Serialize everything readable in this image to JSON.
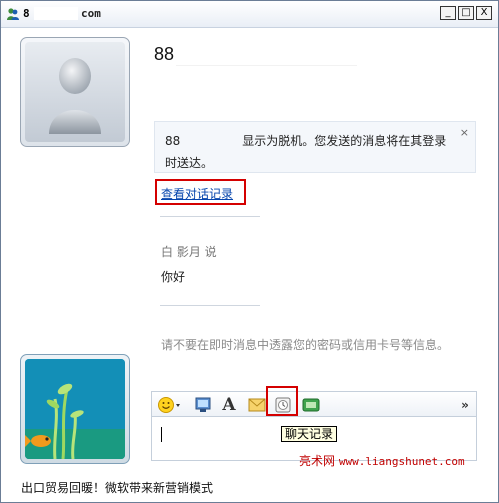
{
  "window": {
    "title_prefix": "8",
    "title_suffix": "com",
    "buttons": [
      "_",
      "□",
      "X"
    ]
  },
  "contact": {
    "name": "88"
  },
  "notice": {
    "id_prefix": "88",
    "text": "显示为脱机。您发送的消息将在其登录时送达。",
    "close": "×"
  },
  "links": {
    "view_history": "查看对话记录"
  },
  "conversation": {
    "sender": "白 影月 说",
    "message": "你好"
  },
  "warning": "请不要在即时消息中透露您的密码或信用卡号等信息。",
  "toolbar": {
    "items": [
      "emoticons-icon",
      "wink-icon",
      "font-icon",
      "nudge-icon",
      "history-icon",
      "games-icon"
    ],
    "more": "»"
  },
  "tooltip": "聊天记录",
  "watermark": {
    "site": "亮术网",
    "url": "www.liangshunet.com"
  },
  "footer": "出口贸易回暖！微软带来新营销模式"
}
